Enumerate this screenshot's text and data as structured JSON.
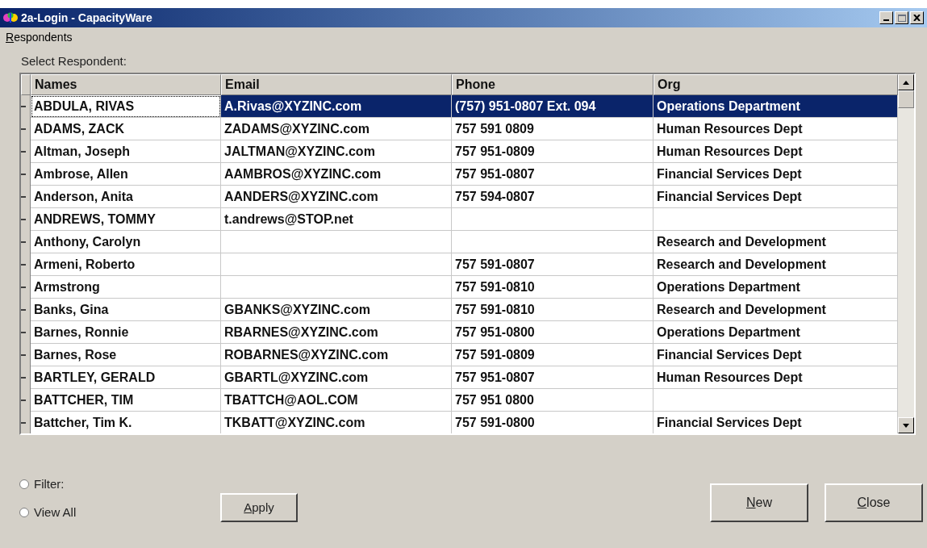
{
  "window": {
    "title": "2a-Login - CapacityWare"
  },
  "menu": [
    {
      "label": "Respondents"
    }
  ],
  "table": {
    "label": "Select Respondent:",
    "columns": [
      "Names",
      "Email",
      "Phone",
      "Org"
    ],
    "rows": [
      {
        "cells": [
          "ABDULA, RIVAS",
          "A.Rivas@XYZINC.com",
          "(757) 951-0807 Ext. 094",
          "Operations Department"
        ],
        "selected": true
      },
      {
        "cells": [
          "ADAMS, ZACK",
          "ZADAMS@XYZINC.com",
          "757 591 0809",
          "Human Resources Dept"
        ],
        "selected": false
      },
      {
        "cells": [
          "Altman, Joseph",
          "JALTMAN@XYZINC.com",
          "757 951-0809",
          "Human Resources Dept"
        ],
        "selected": false
      },
      {
        "cells": [
          "Ambrose, Allen",
          "AAMBROS@XYZINC.com",
          "757 951-0807",
          "Financial Services Dept"
        ],
        "selected": false
      },
      {
        "cells": [
          "Anderson, Anita",
          "AANDERS@XYZINC.com",
          "757 594-0807",
          "Financial Services Dept"
        ],
        "selected": false
      },
      {
        "cells": [
          "ANDREWS, TOMMY",
          "t.andrews@STOP.net",
          "",
          ""
        ],
        "selected": false
      },
      {
        "cells": [
          "Anthony, Carolyn",
          "",
          "",
          "Research and Development"
        ],
        "selected": false
      },
      {
        "cells": [
          "Armeni, Roberto",
          "",
          "757 591-0807",
          "Research and Development"
        ],
        "selected": false
      },
      {
        "cells": [
          "Armstrong",
          "",
          "757 591-0810",
          "Operations Department"
        ],
        "selected": false
      },
      {
        "cells": [
          "Banks, Gina",
          "GBANKS@XYZINC.com",
          "757 591-0810",
          "Research and Development"
        ],
        "selected": false
      },
      {
        "cells": [
          "Barnes, Ronnie",
          "RBARNES@XYZINC.com",
          "757 951-0800",
          "Operations Department"
        ],
        "selected": false
      },
      {
        "cells": [
          "Barnes, Rose",
          "ROBARNES@XYZINC.com",
          "757 591-0809",
          "Financial Services Dept"
        ],
        "selected": false
      },
      {
        "cells": [
          "BARTLEY, GERALD",
          "GBARTL@XYZINC.com",
          "757 951-0807",
          "Human Resources Dept"
        ],
        "selected": false
      },
      {
        "cells": [
          "BATTCHER, TIM",
          "TBATTCH@AOL.COM",
          "757 951 0800",
          ""
        ],
        "selected": false
      },
      {
        "cells": [
          "Battcher, Tim K.",
          "TKBATT@XYZINC.com",
          "757 591-0800",
          "Financial Services Dept"
        ],
        "selected": false
      }
    ]
  },
  "options": [
    {
      "label": "Filter:",
      "selected": false
    },
    {
      "label": "View All",
      "selected": false
    }
  ],
  "apply_button": "Apply",
  "buttons": [
    "New",
    "Close"
  ]
}
